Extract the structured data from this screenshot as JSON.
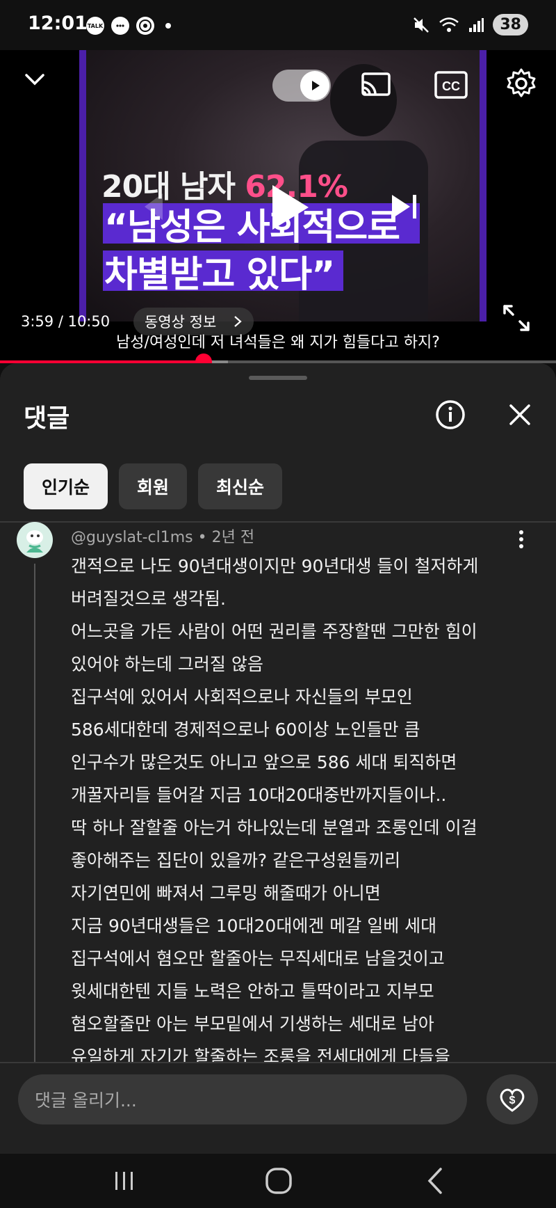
{
  "status_bar": {
    "time": "12:01",
    "notification_icons": [
      "talk-icon",
      "chat-bubble-icon",
      "chrome-icon"
    ],
    "talk_label": "TALK",
    "battery": "38"
  },
  "player": {
    "time": "3:59 / 10:50",
    "info_chip": "동영상 정보",
    "subtitle": "남성/여성인데 저 녀석들은 왜 지가 힘들다고 하지?",
    "progress": 0.366,
    "buffered": 0.41,
    "thumbnail": {
      "line1_prefix": "20대 남자 ",
      "line1_percent": "62.1%",
      "line2": "“남성은 사회적으로",
      "line3": "차별받고 있다”"
    },
    "accent_color": "#ff0033"
  },
  "comments_panel": {
    "title": "댓글",
    "chips": [
      {
        "label": "인기순",
        "active": true
      },
      {
        "label": "회원",
        "active": false
      },
      {
        "label": "최신순",
        "active": false
      }
    ],
    "comment": {
      "author": "@guyslat-cl1ms",
      "time": "2년 전",
      "lines": [
        "갠적으로 나도 90년대생이지만 90년대생 들이 철저하게",
        "버려질것으로 생각됨.",
        "어느곳을 가든 사람이 어떤 권리를 주장할땐 그만한 힘이",
        "있어야 하는데 그러질 않음",
        "집구석에 있어서 사회적으로나 자신들의 부모인",
        "586세대한데 경제적으로나 60이상 노인들만 큼",
        "인구수가 많은것도 아니고 앞으로 586 세대 퇴직하면",
        "개꿀자리들 들어갈 지금 10대20대중반까지들이나..",
        "딱 하나 잘할줄 아는거 하나있는데 분열과 조롱인데 이걸",
        "좋아해주는 집단이 있을까? 같은구성원들끼리",
        "자기연민에 빠져서 그루밍 해줄때가 아니면",
        "지금 90년대생들은 10대20대에겐 메갈 일베 세대",
        "집구석에서 혐오만 할줄아는 무직세대로 남을것이고",
        "윗세대한텐 지들 노력은 안하고 틀딱이라고 지부모",
        "혐오할줄만 아는 부모밑에서 기생하는 세대로 남아",
        "유일하게 자기가 할줄하는 조롱을 전세대에게 다들을"
      ]
    },
    "input_placeholder": "댓글 올리기..."
  }
}
